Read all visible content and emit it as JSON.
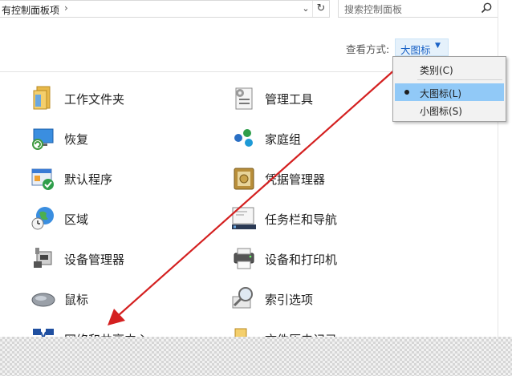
{
  "address_bar": {
    "path": "有控制面板项",
    "chevron": "›"
  },
  "search": {
    "placeholder": "搜索控制面板"
  },
  "view_by": {
    "label": "查看方式:",
    "value": "大图标"
  },
  "view_menu": {
    "items": [
      {
        "label": "类别(C)",
        "selected": false
      },
      {
        "label": "大图标(L)",
        "selected": true
      },
      {
        "label": "小图标(S)",
        "selected": false
      }
    ]
  },
  "items": [
    {
      "label": "工作文件夹",
      "icon": "work-folders-icon"
    },
    {
      "label": "管理工具",
      "icon": "admin-tools-icon"
    },
    {
      "label": "恢复",
      "icon": "recovery-icon"
    },
    {
      "label": "家庭组",
      "icon": "homegroup-icon"
    },
    {
      "label": "默认程序",
      "icon": "default-programs-icon"
    },
    {
      "label": "凭据管理器",
      "icon": "credential-manager-icon"
    },
    {
      "label": "区域",
      "icon": "region-icon"
    },
    {
      "label": "任务栏和导航",
      "icon": "taskbar-navigation-icon"
    },
    {
      "label": "设备管理器",
      "icon": "device-manager-icon"
    },
    {
      "label": "设备和打印机",
      "icon": "devices-printers-icon"
    },
    {
      "label": "鼠标",
      "icon": "mouse-icon"
    },
    {
      "label": "索引选项",
      "icon": "indexing-options-icon"
    },
    {
      "label": "网络和共享中心",
      "icon": "network-sharing-center-icon"
    },
    {
      "label": "文件历史记录",
      "icon": "file-history-icon"
    }
  ],
  "colors": {
    "accent": "#1a62c6",
    "menu_highlight": "#91c9f7",
    "annotation_arrow": "#d42020"
  }
}
